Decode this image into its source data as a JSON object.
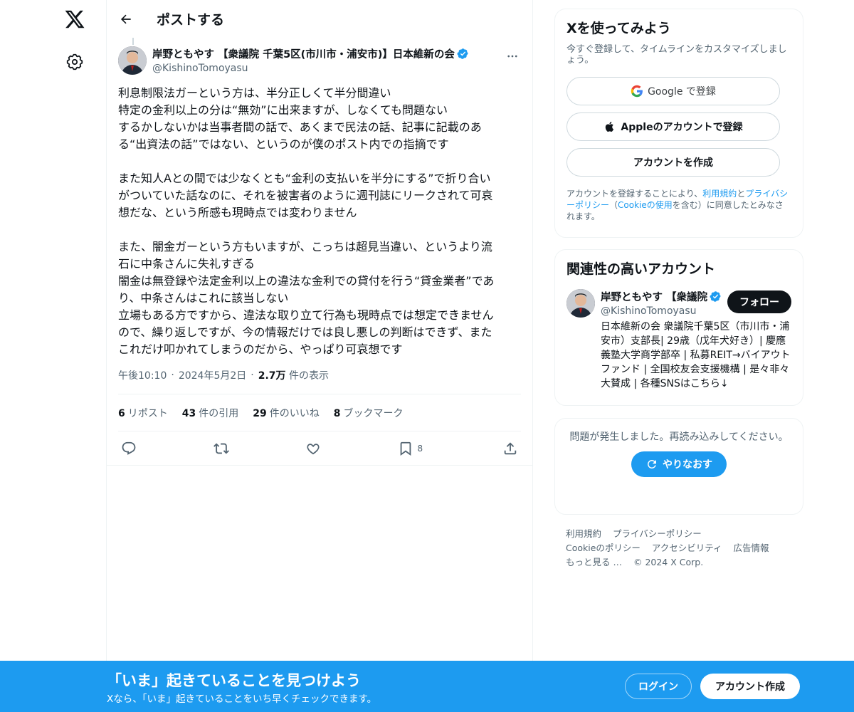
{
  "header": {
    "title": "ポストする"
  },
  "post": {
    "author_name": "岸野ともやす 【衆議院 千葉5区(市川市・浦安市)】日本維新の会",
    "author_handle": "@KishinoTomoyasu",
    "text": "利息制限法ガーという方は、半分正しくて半分間違い\n特定の金利以上の分は“無効”に出来ますが、しなくても問題ない\nするかしないかは当事者間の話で、あくまで民法の話、記事に記載のあ\nる“出資法の話”ではない、というのが僕のポスト内での指摘です\n\nまた知人Aとの間では少なくとも“金利の支払いを半分にする”で折り合い\nがついていた話なのに、それを被害者のように週刊誌にリークされて可哀\n想だな、という所感も現時点では変わりません\n\nまた、闇金ガーという方もいますが、こっちは超見当違い、というより流\n石に中条さんに失礼すぎる\n闇金は無登録や法定金利以上の違法な金利での貸付を行う“貸金業者”であ\nり、中条さんはこれに該当しない\n立場もある方ですから、違法な取り立て行為も現時点では想定できません\nので、繰り返しですが、今の情報だけでは良し悪しの判断はできず、また\nこれだけ叩かれてしまうのだから、やっぱり可哀想です",
    "time": "午後10:10",
    "date": "2024年5月2日",
    "views_count": "2.7万",
    "views_label": "件の表示",
    "reposts_count": "6",
    "reposts_label": "リポスト",
    "quotes_count": "43",
    "quotes_label": "件の引用",
    "likes_count": "29",
    "likes_label": "件のいいね",
    "bookmarks_count": "8",
    "bookmarks_label": "ブックマーク",
    "bookmark_action_count": "8"
  },
  "signup": {
    "title": "Xを使ってみよう",
    "subtitle": "今すぐ登録して、タイムラインをカスタマイズしましょう。",
    "google_label": "Google で登録",
    "apple_label": "Appleのアカウントで登録",
    "create_label": "アカウントを作成",
    "terms_prefix": "アカウントを登録することにより、",
    "terms_link": "利用規約",
    "terms_and": "と",
    "privacy_link": "プライバシーポリシー",
    "cookie_open": "（",
    "cookie_link": "Cookieの使用",
    "terms_suffix": "を含む）に同意したとみなされます。"
  },
  "related": {
    "title": "関連性の高いアカウント",
    "name": "岸野ともやす 【衆議院",
    "handle": "@KishinoTomoyasu",
    "follow_label": "フォロー",
    "bio": "日本維新の会 衆議院千葉5区（市川市・浦安市）支部長| 29歳（戊年犬好き）| 慶應義塾大学商学部卒 | 私募REIT→バイアウトファンド | 全国校友会支援機構 | 是々非々大賛成 | 各種SNSはこちら↓"
  },
  "error": {
    "message": "問題が発生しました。再読み込みしてください。",
    "retry_label": "やりなおす"
  },
  "footer": {
    "terms": "利用規約",
    "privacy": "プライバシーポリシー",
    "cookie": "Cookieのポリシー",
    "accessibility": "アクセシビリティ",
    "ads": "広告情報",
    "more": "もっと見る …",
    "copyright": "© 2024 X Corp."
  },
  "banner": {
    "title": "「いま」起きていることを見つけよう",
    "subtitle": "Xなら、「いま」起きていることをいち早くチェックできます。",
    "login_label": "ログイン",
    "create_label": "アカウント作成"
  },
  "colors": {
    "accent": "#1d9bf0",
    "text": "#0f1419",
    "muted": "#536471",
    "border": "#eff3f4"
  },
  "icons": [
    "x-logo-icon",
    "gear-icon",
    "back-arrow-icon",
    "verified-badge-icon",
    "more-icon",
    "reply-icon",
    "repost-icon",
    "like-icon",
    "bookmark-icon",
    "share-icon",
    "google-icon",
    "apple-icon",
    "refresh-icon"
  ]
}
